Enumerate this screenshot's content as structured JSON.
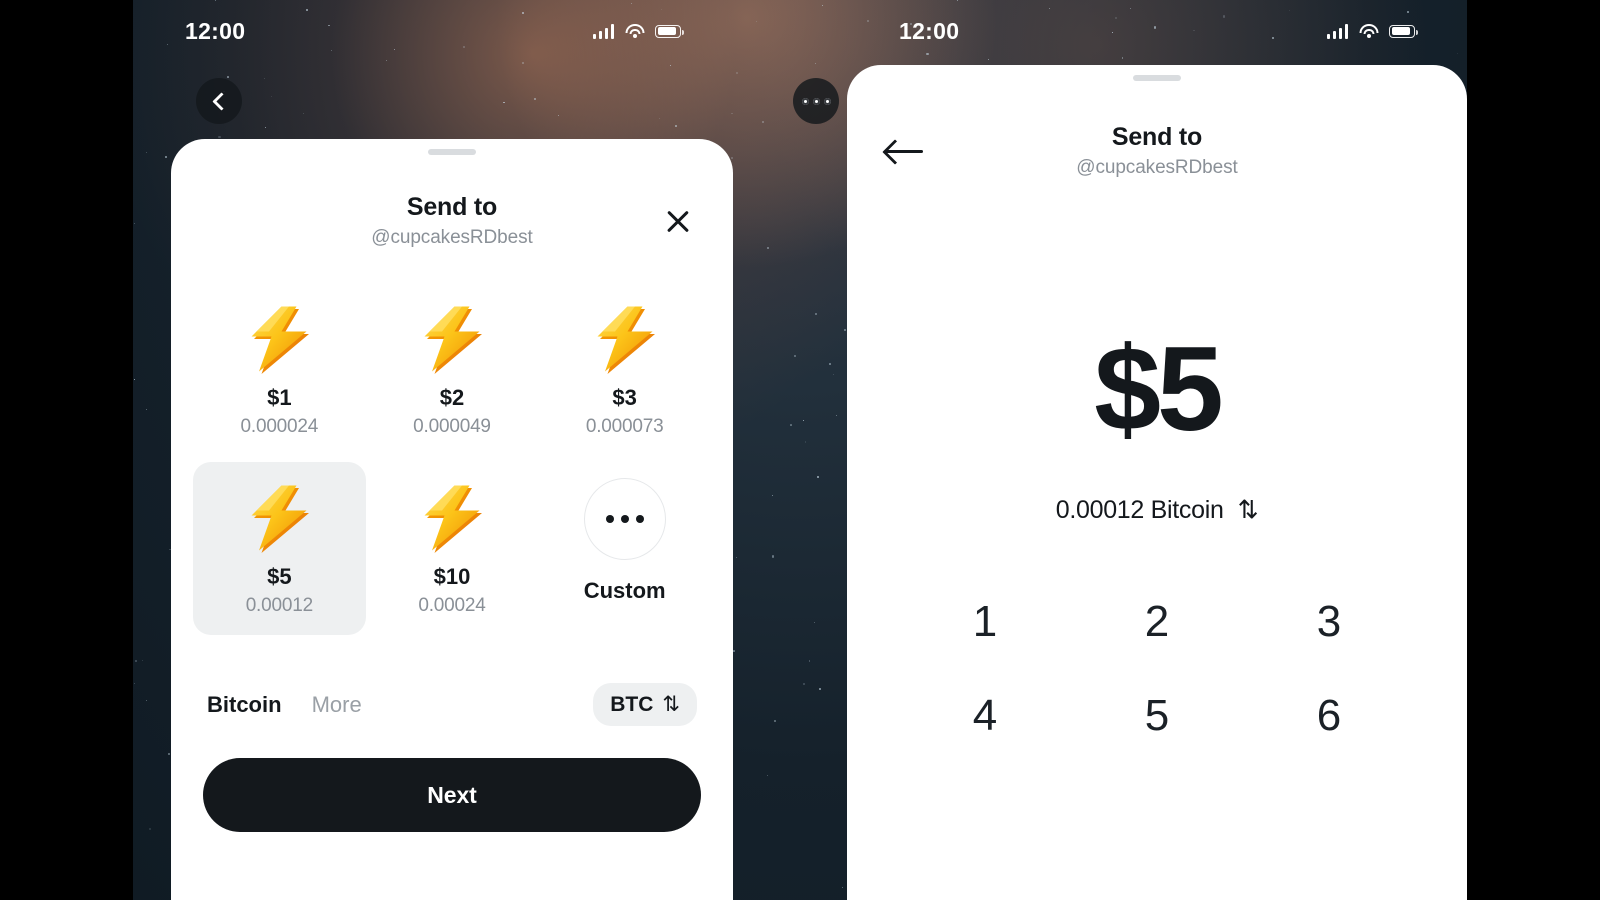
{
  "status_bar": {
    "time": "12:00",
    "icons": [
      "signal-bars-icon",
      "wifi-icon",
      "battery-icon"
    ]
  },
  "left_phone": {
    "nav": {
      "back_icon": "chevron-left-icon",
      "more_icon": "three-dots-icon"
    },
    "sheet": {
      "title": "Send to",
      "handle": "@cupcakesRDbest",
      "close_icon": "close-x-icon",
      "amounts": [
        {
          "icon": "lightning-bolt-icon",
          "amount": "$1",
          "btc": "0.000024",
          "selected": false
        },
        {
          "icon": "lightning-bolt-icon",
          "amount": "$2",
          "btc": "0.000049",
          "selected": false
        },
        {
          "icon": "lightning-bolt-icon",
          "amount": "$3",
          "btc": "0.000073",
          "selected": false
        },
        {
          "icon": "lightning-bolt-icon",
          "amount": "$5",
          "btc": "0.00012",
          "selected": true
        },
        {
          "icon": "lightning-bolt-icon",
          "amount": "$10",
          "btc": "0.00024",
          "selected": false
        }
      ],
      "custom": {
        "icon": "three-dots-icon",
        "label": "Custom"
      },
      "currency_tabs": [
        {
          "label": "Bitcoin",
          "active": true
        },
        {
          "label": "More",
          "active": false
        }
      ],
      "unit_chip": {
        "label": "BTC",
        "swap_icon": "⇅"
      },
      "primary_button": "Next"
    }
  },
  "right_phone": {
    "sheet": {
      "back_icon": "arrow-left-icon",
      "title": "Send to",
      "handle": "@cupcakesRDbest",
      "amount": "$5",
      "converted": "0.00012 Bitcoin",
      "swap_icon": "⇅",
      "keypad": [
        "1",
        "2",
        "3",
        "4",
        "5",
        "6"
      ]
    }
  },
  "colors": {
    "ink": "#14181c",
    "muted": "#8a9097",
    "tile_selected": "#eef0f1",
    "bolt_yellow": "#fcc419",
    "bolt_orange": "#f08c00",
    "wallpaper_dark": "#15212b"
  }
}
